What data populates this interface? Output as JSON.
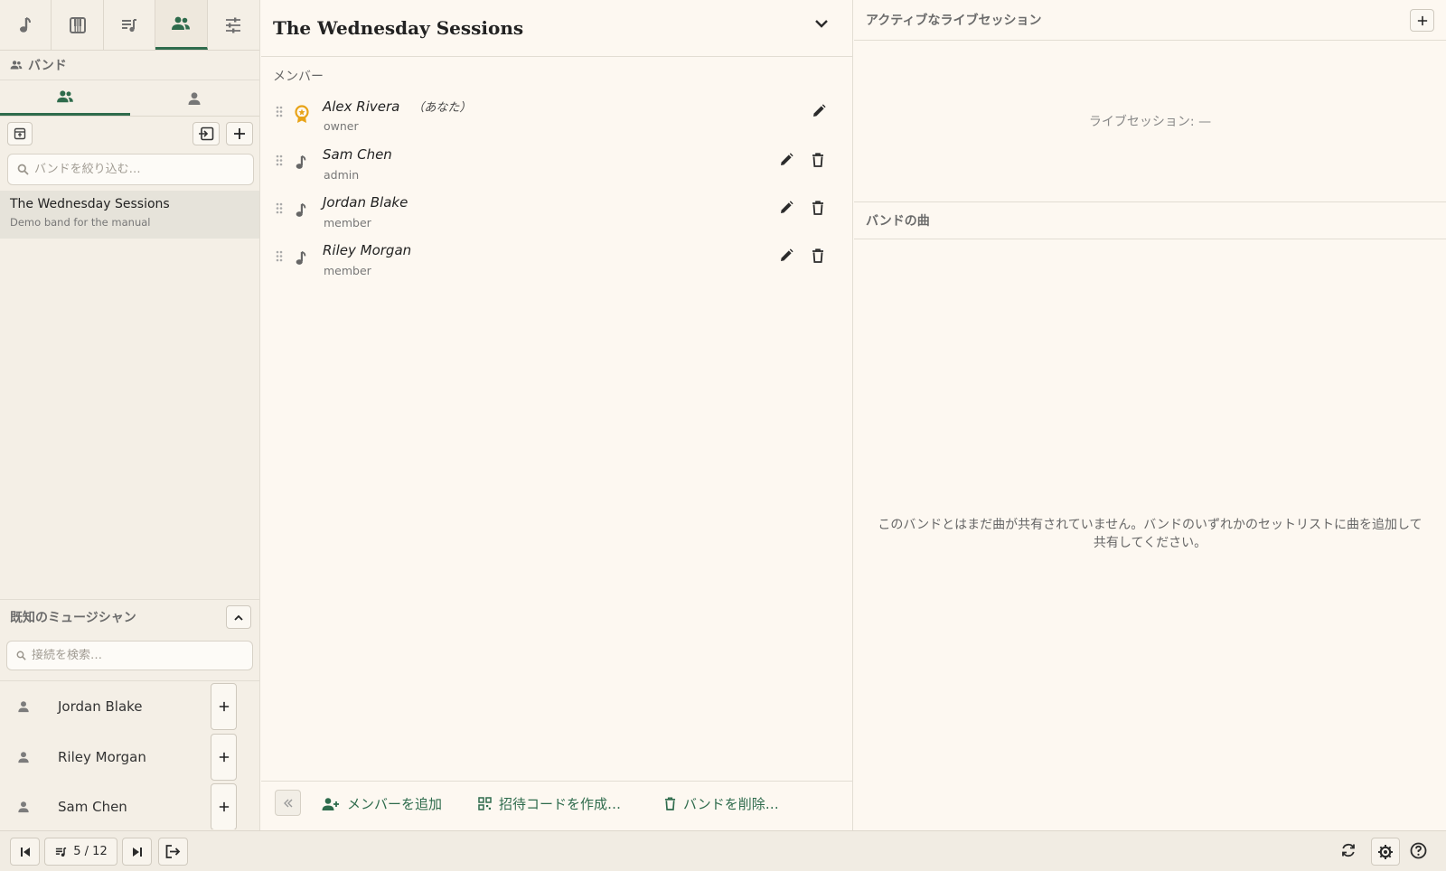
{
  "nav": {
    "tabs": [
      {
        "icon": "music-note-icon"
      },
      {
        "icon": "piano-icon"
      },
      {
        "icon": "setlist-icon"
      },
      {
        "icon": "people-icon",
        "active": true
      },
      {
        "icon": "sliders-icon"
      }
    ]
  },
  "sidebar": {
    "section_title": "バンド",
    "subtabs": [
      {
        "icon": "people-icon",
        "active": true
      },
      {
        "icon": "person-icon"
      }
    ],
    "filter_placeholder": "バンドを絞り込む…",
    "bands": [
      {
        "name": "The Wednesday Sessions",
        "description": "Demo band for the manual"
      }
    ],
    "known_title": "既知のミュージシャン",
    "connection_placeholder": "接続を検索…",
    "musicians": [
      {
        "name": "Jordan Blake"
      },
      {
        "name": "Riley Morgan"
      },
      {
        "name": "Sam Chen"
      }
    ]
  },
  "band": {
    "title": "The Wednesday Sessions",
    "members_label": "メンバー",
    "members": [
      {
        "name": "Alex Rivera",
        "you": "（あなた）",
        "role": "owner",
        "icon": "award-icon",
        "deletable": false
      },
      {
        "name": "Sam Chen",
        "you": "",
        "role": "admin",
        "icon": "music-note-icon",
        "deletable": true
      },
      {
        "name": "Jordan Blake",
        "you": "",
        "role": "member",
        "icon": "music-note-icon",
        "deletable": true
      },
      {
        "name": "Riley Morgan",
        "you": "",
        "role": "member",
        "icon": "music-note-icon",
        "deletable": true
      }
    ],
    "footer": {
      "add_member": "メンバーを追加",
      "invite_code": "招待コードを作成…",
      "delete_band": "バンドを削除…"
    }
  },
  "right": {
    "live_title": "アクティブなライブセッション",
    "live_empty": "ライブセッション: —",
    "songs_title": "バンドの曲",
    "songs_empty": "このバンドとはまだ曲が共有されていません。バンドのいずれかのセットリストに曲を追加して共有してください。"
  },
  "bottombar": {
    "setlist_position": "5 / 12"
  },
  "colors": {
    "accent": "#2e6b4c",
    "owner_badge": "#e8a317",
    "background": "#fdf8f1",
    "sidebar": "#f4efe6"
  }
}
